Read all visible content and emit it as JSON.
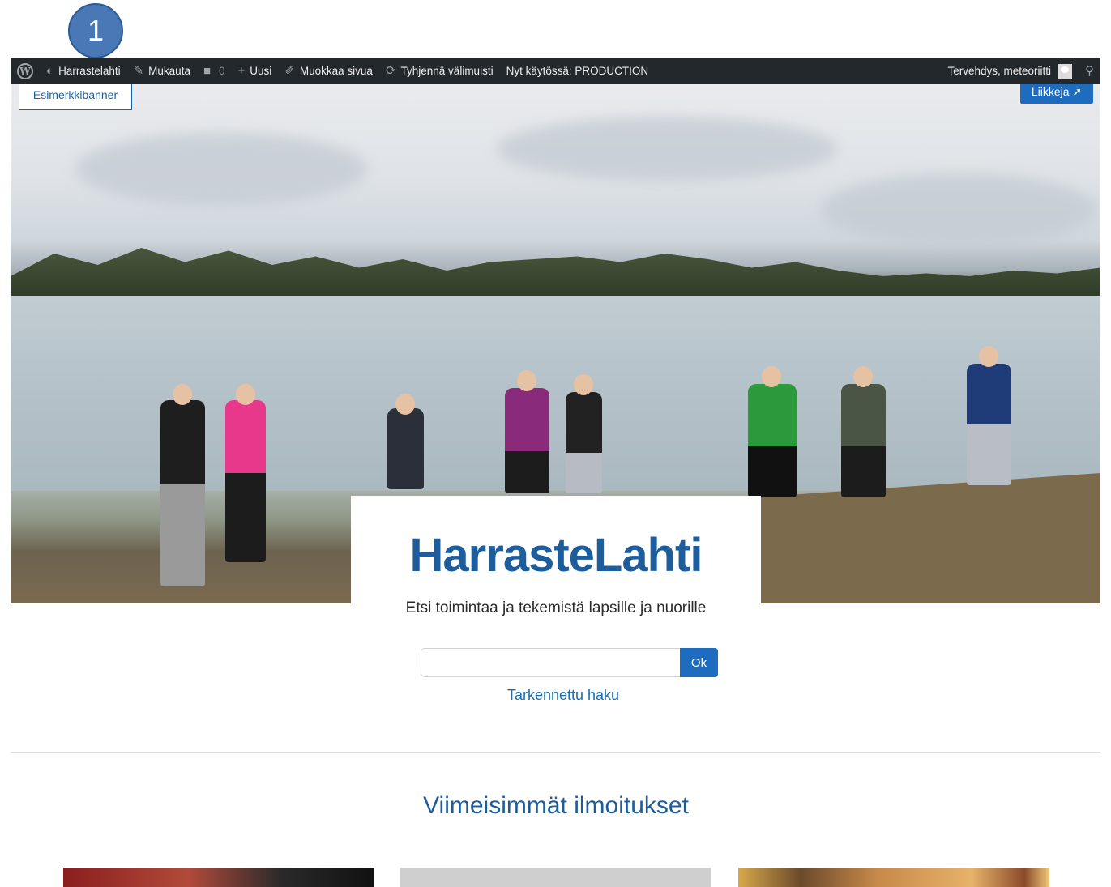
{
  "annotation": {
    "marker": "1"
  },
  "adminbar": {
    "site_name": "Harrastelahti",
    "customize": "Mukauta",
    "comments_count": "0",
    "new": "Uusi",
    "edit_page": "Muokkaa sivua",
    "clear_cache": "Tyhjennä välimuisti",
    "environment": "Nyt käytössä: PRODUCTION",
    "greeting": "Tervehdys, meteoriitti"
  },
  "hero": {
    "left_button": "Esimerkkibanner",
    "right_button": "Liikkeja ➚"
  },
  "brand": {
    "title": "HarrasteLahti",
    "tagline": "Etsi toimintaa ja tekemistä lapsille ja nuorille"
  },
  "search": {
    "value": "",
    "button": "Ok",
    "advanced": "Tarkennettu haku"
  },
  "latest": {
    "title": "Viimeisimmät ilmoitukset"
  },
  "colors": {
    "adminbar_bg": "#23282d",
    "brand_blue": "#1d5d9b",
    "button_blue": "#1e6cbf"
  }
}
